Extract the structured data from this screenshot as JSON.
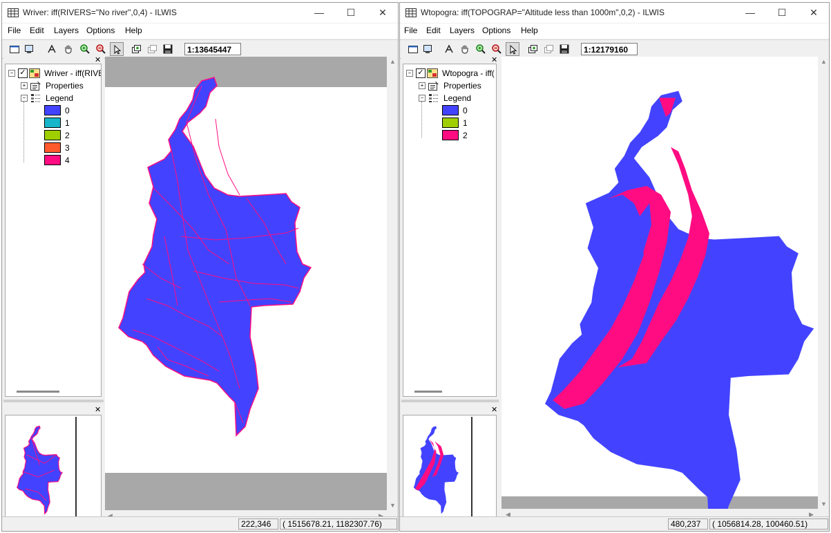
{
  "colors": {
    "class0": "#4343ff",
    "class1": "#17b5c9",
    "class2": "#9fcf00",
    "class3": "#ff5a2e",
    "class4": "#ff0c82",
    "map_background": "#a8a8a8"
  },
  "menu": [
    "File",
    "Edit",
    "Layers",
    "Options",
    "Help"
  ],
  "windows": [
    {
      "title": "Wriver: iff(RIVERS=\"No river\",0,4) - ILWIS",
      "scale": "1:13645447",
      "layer_name": "Wriver - iff(RIVERS",
      "properties_label": "Properties",
      "legend_label": "Legend",
      "legend": [
        "0",
        "1",
        "2",
        "3",
        "4"
      ],
      "status_pixel": "222,346",
      "status_coords": "(  1515678.21,   1182307.76)"
    },
    {
      "title": "Wtopogra: iff(TOPOGRAP=\"Altitude less than 1000m\",0,2) - ILWIS",
      "scale": "1:12179160",
      "layer_name": "Wtopogra - iff(",
      "properties_label": "Properties",
      "legend_label": "Legend",
      "legend": [
        "0",
        "1",
        "2"
      ],
      "status_pixel": "480,237",
      "status_coords": "(  1056814.28,    100460.51)"
    }
  ]
}
